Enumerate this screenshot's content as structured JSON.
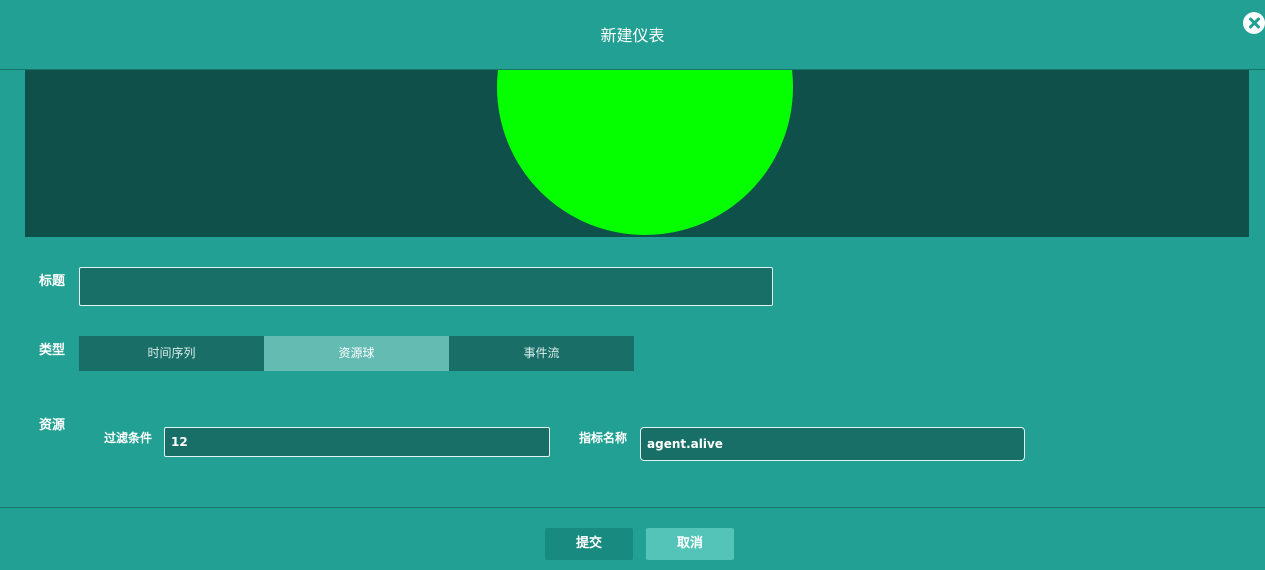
{
  "dialog": {
    "title": "新建仪表"
  },
  "form": {
    "title_label": "标题",
    "title_value": "",
    "type_label": "类型",
    "type_options": [
      "时间序列",
      "资源球",
      "事件流"
    ],
    "type_selected": "资源球",
    "resource_label": "资源",
    "filter_label": "过滤条件",
    "filter_value": "12",
    "metric_label": "指标名称",
    "metric_value": "agent.alive"
  },
  "footer": {
    "submit_label": "提交",
    "cancel_label": "取消"
  },
  "colors": {
    "background": "#21a093",
    "preview_bg": "#10504b",
    "ball": "#05ff00",
    "type_active": "#63bbb2",
    "submit": "#198a7f",
    "cancel": "#55c4b8"
  }
}
